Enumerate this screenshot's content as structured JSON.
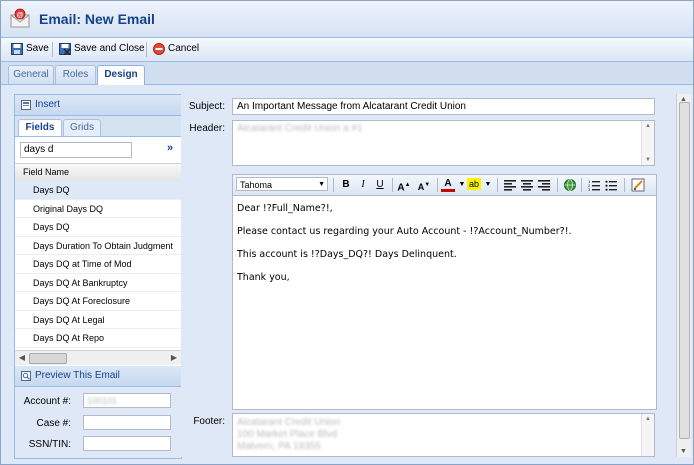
{
  "window": {
    "title": "Email: New Email"
  },
  "toolbar": {
    "save": "Save",
    "save_close": "Save and Close",
    "cancel": "Cancel"
  },
  "tabs": [
    {
      "label": "General"
    },
    {
      "label": "Roles"
    },
    {
      "label": "Design"
    }
  ],
  "left": {
    "insert": "Insert",
    "subtabs": [
      {
        "label": "Fields"
      },
      {
        "label": "Grids"
      }
    ],
    "filter_value": "days d",
    "expand": "»",
    "column": "Field Name",
    "fields": [
      "Days DQ",
      "Original Days DQ",
      "Days DQ",
      "Days Duration To Obtain Judgment",
      "Days DQ at Time of Mod",
      "Days DQ At Bankruptcy",
      "Days DQ At Foreclosure",
      "Days DQ At Legal",
      "Days DQ At Repo"
    ],
    "preview": "Preview This Email",
    "account_label": "Account #:",
    "account_value": "100101",
    "case_label": "Case #:",
    "ssn_label": "SSN/TIN:"
  },
  "right": {
    "subject_label": "Subject:",
    "subject_value": "An Important Message from Alcatarant Credit Union",
    "header_label": "Header:",
    "header_value": "Alcatarant Credit Union a #1",
    "font": "Tahoma",
    "body": [
      "Dear !?Full_Name?!,",
      "Please contact us regarding your Auto Account - !?Account_Number?!.",
      "This account is !?Days_DQ?! Days Delinquent.",
      "Thank you,"
    ],
    "footer_label": "Footer:",
    "footer_lines": [
      "Alcatarant Credit Union",
      "100 Market Place Blvd",
      "Malvern, PA 19355"
    ]
  },
  "colors": {
    "accent": "#15428b",
    "border": "#99bbe8",
    "panel": "#dfe8f6"
  },
  "icons": {
    "save": "floppy-disk-icon",
    "save_close": "save-close-icon",
    "cancel": "cancel-icon",
    "app": "email-envelope-icon"
  }
}
